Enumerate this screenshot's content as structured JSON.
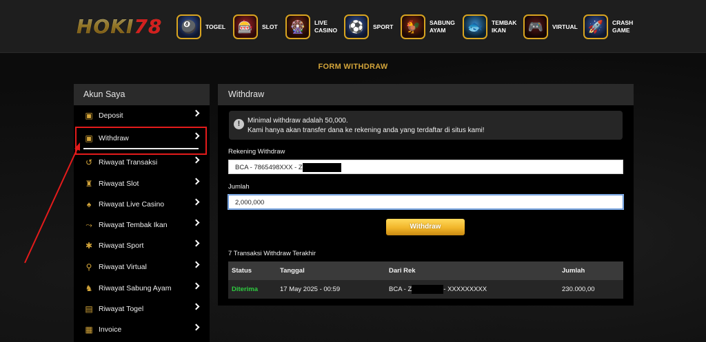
{
  "brand": {
    "logo_text": "HOKI",
    "logo_num": "78"
  },
  "nav": [
    {
      "label": "TOGEL",
      "icon": "lottery-ball-icon"
    },
    {
      "label": "SLOT",
      "icon": "slot-machine-icon"
    },
    {
      "label": "LIVE\nCASINO",
      "icon": "roulette-icon"
    },
    {
      "label": "SPORT",
      "icon": "soccer-icon"
    },
    {
      "label": "SABUNG\nAYAM",
      "icon": "rooster-icon"
    },
    {
      "label": "TEMBAK\nIKAN",
      "icon": "fish-icon"
    },
    {
      "label": "VIRTUAL",
      "icon": "gamepad-icon"
    },
    {
      "label": "CRASH\nGAME",
      "icon": "rocket-icon"
    }
  ],
  "page_title": "FORM WITHDRAW",
  "sidebar": {
    "title": "Akun Saya",
    "items": [
      {
        "label": "Deposit",
        "icon": "wallet-icon"
      },
      {
        "label": "Withdraw",
        "icon": "wallet-out-icon"
      },
      {
        "label": "Riwayat Transaksi",
        "icon": "history-icon"
      },
      {
        "label": "Riwayat Slot",
        "icon": "slot-icon"
      },
      {
        "label": "Riwayat Live Casino",
        "icon": "cards-icon"
      },
      {
        "label": "Riwayat Tembak Ikan",
        "icon": "fishing-icon"
      },
      {
        "label": "Riwayat Sport",
        "icon": "sport-icon"
      },
      {
        "label": "Riwayat Virtual",
        "icon": "joystick-icon"
      },
      {
        "label": "Riwayat Sabung Ayam",
        "icon": "rooster-icon"
      },
      {
        "label": "Riwayat Togel",
        "icon": "ticket-icon"
      },
      {
        "label": "Invoice",
        "icon": "invoice-icon"
      }
    ],
    "selected_index": 1
  },
  "withdraw": {
    "title": "Withdraw",
    "notice_line1": "Minimal withdraw adalah 50,000.",
    "notice_line2": "Kami hanya akan transfer dana ke rekening anda yang terdaftar di situs kami!",
    "account_label": "Rekening Withdraw",
    "account_value": "BCA - 7865498XXX - Z",
    "amount_label": "Jumlah",
    "amount_value": "2,000,000",
    "button_label": "Withdraw",
    "history_title": "7 Transaksi Withdraw Terakhir",
    "table": {
      "headers": [
        "Status",
        "Tanggal",
        "Dari Rek",
        "Jumlah"
      ],
      "rows": [
        {
          "status": "Diterima",
          "date": "17 May 2025 - 00:59",
          "from_prefix": "BCA - Z",
          "from_suffix": "- XXXXXXXXX",
          "amount": "230.000,00"
        }
      ]
    }
  },
  "colors": {
    "accent_gold": "#d4a53a",
    "status_ok": "#2ecc40",
    "annotation_red": "#e51b1b"
  }
}
